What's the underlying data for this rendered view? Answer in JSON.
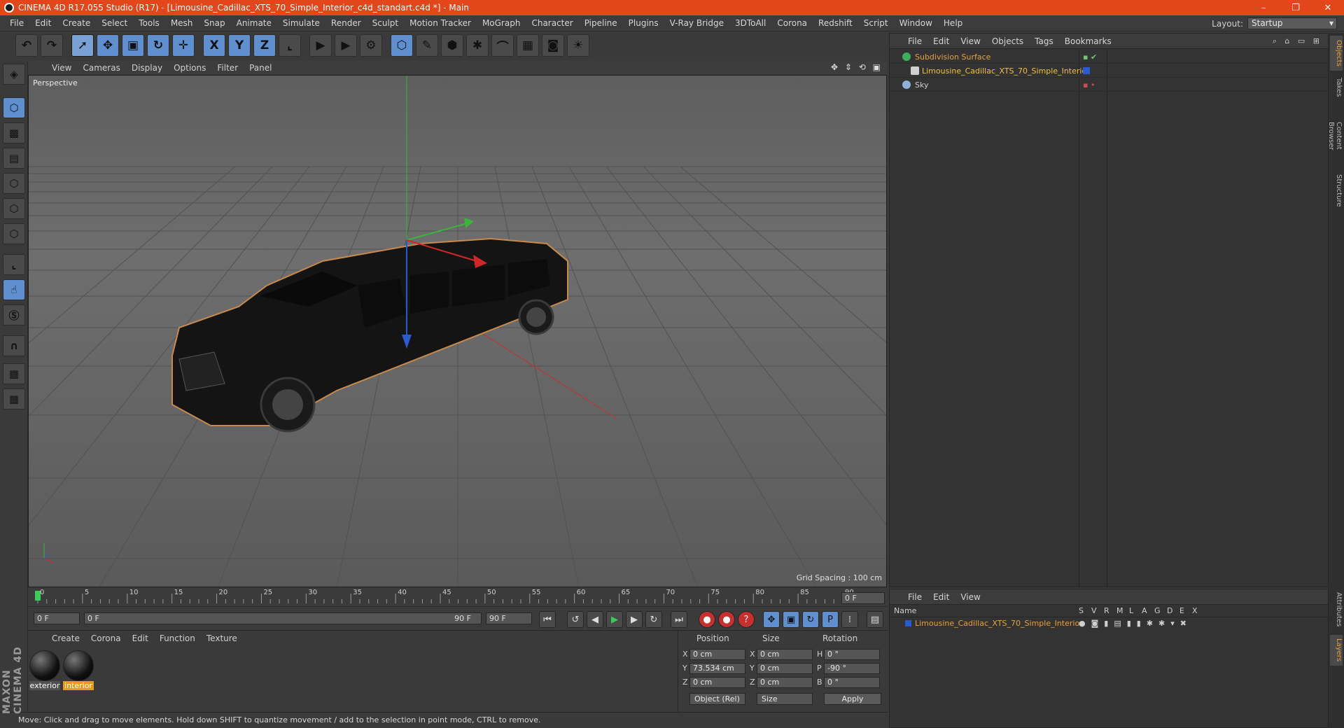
{
  "title": "CINEMA 4D R17.055 Studio (R17) - [Limousine_Cadillac_XTS_70_Simple_Interior_c4d_standart.c4d *] - Main",
  "window_buttons": [
    "–",
    "❐",
    "✕"
  ],
  "menu": [
    "File",
    "Edit",
    "Create",
    "Select",
    "Tools",
    "Mesh",
    "Snap",
    "Animate",
    "Simulate",
    "Render",
    "Sculpt",
    "Motion Tracker",
    "MoGraph",
    "Character",
    "Pipeline",
    "Plugins",
    "V-Ray Bridge",
    "3DToAll",
    "Corona",
    "Redshift",
    "Script",
    "Window",
    "Help"
  ],
  "layout": {
    "label": "Layout:",
    "value": "Startup"
  },
  "toolbar_axes": [
    "X",
    "Y",
    "Z"
  ],
  "viewport": {
    "menu": [
      "View",
      "Cameras",
      "Display",
      "Options",
      "Filter",
      "Panel"
    ],
    "label": "Perspective",
    "grid_spacing": "Grid Spacing : 100 cm"
  },
  "timeline": {
    "ticks": [
      "0",
      "5",
      "10",
      "15",
      "20",
      "25",
      "30",
      "35",
      "40",
      "45",
      "50",
      "55",
      "60",
      "65",
      "70",
      "75",
      "80",
      "85",
      "90"
    ],
    "current_frame": "0 F",
    "start_field": "0 F",
    "range_start": "0 F",
    "range_end": "90 F",
    "end_field": "90 F"
  },
  "materials": {
    "menu": [
      "Create",
      "Corona",
      "Edit",
      "Function",
      "Texture"
    ],
    "items": [
      {
        "name": "exterior",
        "highlight": "#505050"
      },
      {
        "name": "interior",
        "highlight": "#e89a1a"
      }
    ]
  },
  "coordinates": {
    "headers": [
      "Position",
      "Size",
      "Rotation"
    ],
    "rows": [
      {
        "axis": "X",
        "pos": "0 cm",
        "size_axis": "X",
        "size": "0 cm",
        "rot_axis": "H",
        "rot": "0 °"
      },
      {
        "axis": "Y",
        "pos": "73.534 cm",
        "size_axis": "Y",
        "size": "0 cm",
        "rot_axis": "P",
        "rot": "-90 °"
      },
      {
        "axis": "Z",
        "pos": "0 cm",
        "size_axis": "Z",
        "size": "0 cm",
        "rot_axis": "B",
        "rot": "0 °"
      }
    ],
    "mode": "Object (Rel)",
    "size_mode": "Size",
    "apply": "Apply"
  },
  "status": "Move: Click and drag to move elements. Hold down SHIFT to quantize movement / add to the selection in point mode, CTRL to remove.",
  "brand": "MAXON CINEMA 4D",
  "objects": {
    "menu": [
      "File",
      "Edit",
      "View",
      "Objects",
      "Tags",
      "Bookmarks"
    ],
    "items": [
      {
        "name": "Subdivision Surface",
        "color": "#e8a040",
        "icon_color": "#3fae5a"
      },
      {
        "name": "Limousine_Cadillac_XTS_70_Simple_Interior",
        "color": "#f0c040",
        "icon_color": "#cfcfcf"
      },
      {
        "name": "Sky",
        "color": "#cfcfcf",
        "icon_color": "#8fb0d8"
      }
    ]
  },
  "layers": {
    "menu": [
      "File",
      "Edit",
      "View"
    ],
    "header_name": "Name",
    "header_cols": [
      "S",
      "V",
      "R",
      "M",
      "L",
      "A",
      "G",
      "D",
      "E",
      "X"
    ],
    "row_name": "Limousine_Cadillac_XTS_70_Simple_Interior"
  },
  "right_tabs": [
    "Objects",
    "Takes",
    "Content Browser",
    "Structure",
    "Attributes",
    "Layers"
  ],
  "colors": {
    "titlebar": "#e2461a",
    "accent_orange": "#e8a040",
    "selection_blue": "#5f8fcf"
  }
}
